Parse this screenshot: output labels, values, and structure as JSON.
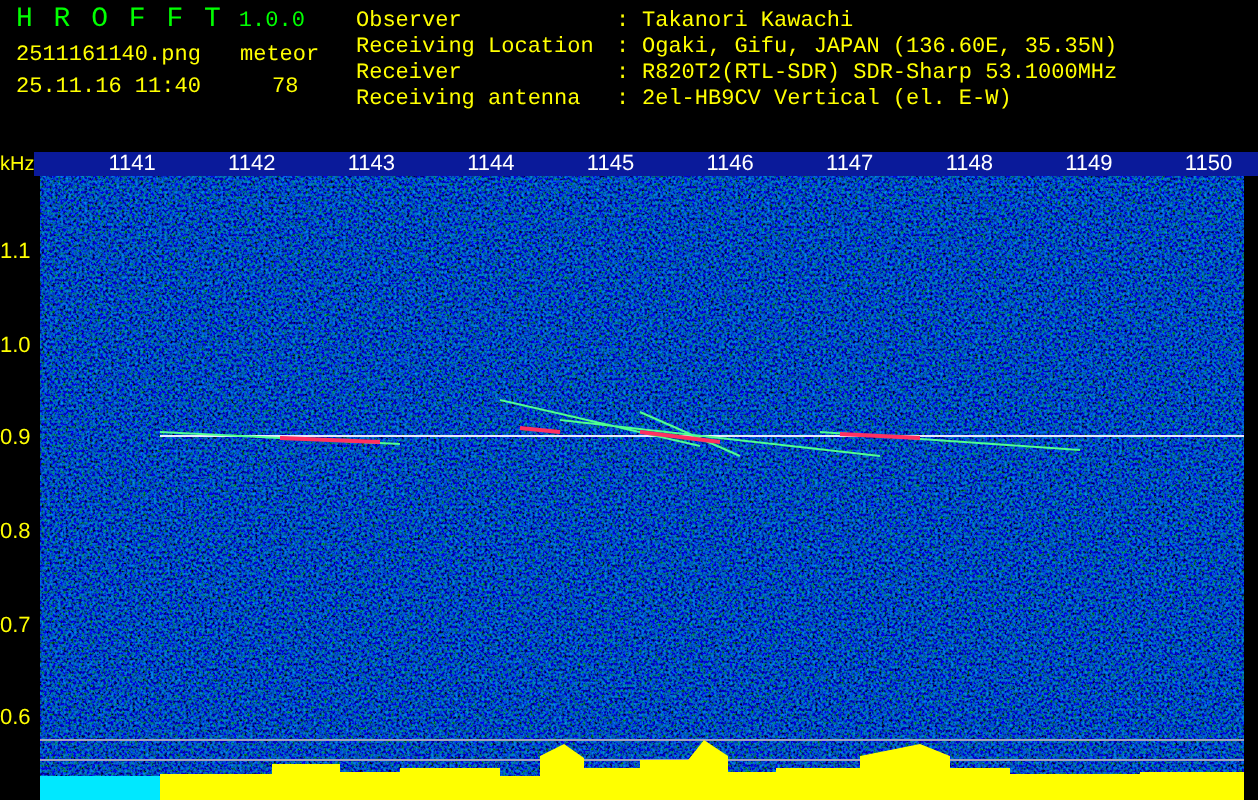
{
  "header": {
    "app_name": "H R O F F T",
    "version": "1.0.0",
    "filename": "2511161140.png",
    "datetime": "25.11.16 11:40",
    "count_label": "meteor",
    "count": "78",
    "info": [
      {
        "label": "Observer",
        "separator": ":",
        "value": "Takanori Kawachi"
      },
      {
        "label": "Receiving Location",
        "separator": ":",
        "value": "Ogaki, Gifu, JAPAN (136.60E, 35.35N)"
      },
      {
        "label": "Receiver",
        "separator": ":",
        "value": "R820T2(RTL-SDR) SDR-Sharp 53.1000MHz"
      },
      {
        "label": "Receiving antenna",
        "separator": ":",
        "value": "2el-HB9CV Vertical (el. E-W)"
      }
    ]
  },
  "spectrogram": {
    "y_unit": "kHz",
    "x_ticks": [
      "1141",
      "1142",
      "1143",
      "1144",
      "1145",
      "1146",
      "1147",
      "1148",
      "1149",
      "1150"
    ],
    "y_ticks": [
      "1.1",
      "1.0",
      "0.9",
      "0.8",
      "0.7",
      "0.6"
    ]
  }
}
